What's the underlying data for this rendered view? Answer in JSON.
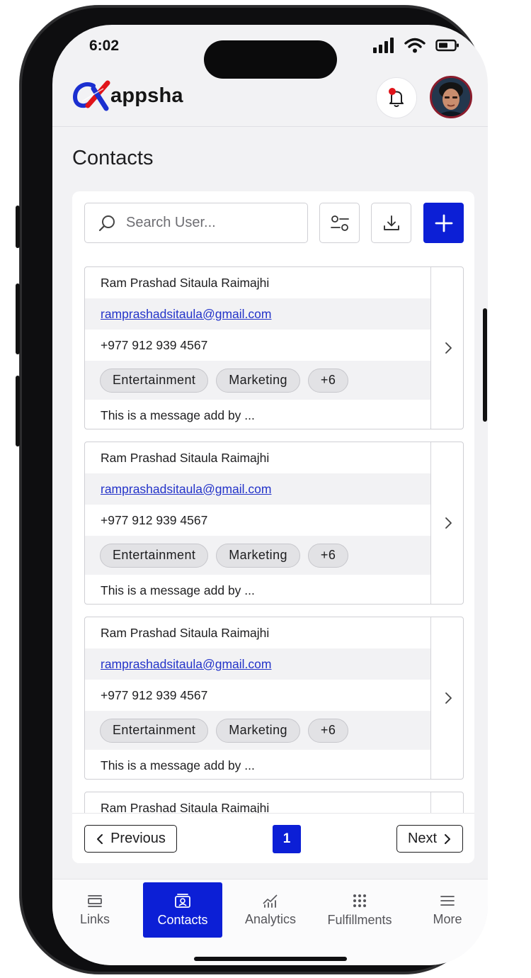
{
  "status_bar": {
    "time": "6:02"
  },
  "brand": {
    "name": "appsha"
  },
  "page": {
    "title": "Contacts"
  },
  "toolbar": {
    "search_placeholder": "Search User..."
  },
  "contacts": [
    {
      "name": "Ram Prashad Sitaula Raimajhi",
      "email": "ramprashadsitaula@gmail.com",
      "phone": "+977 912 939 4567",
      "tags": [
        "Entertainment",
        "Marketing",
        "+6"
      ],
      "message": "This is a message add by ..."
    },
    {
      "name": "Ram Prashad Sitaula Raimajhi",
      "email": "ramprashadsitaula@gmail.com",
      "phone": "+977 912 939 4567",
      "tags": [
        "Entertainment",
        "Marketing",
        "+6"
      ],
      "message": "This is a message add by ..."
    },
    {
      "name": "Ram Prashad Sitaula Raimajhi",
      "email": "ramprashadsitaula@gmail.com",
      "phone": "+977 912 939 4567",
      "tags": [
        "Entertainment",
        "Marketing",
        "+6"
      ],
      "message": "This is a message add by ..."
    },
    {
      "name": "Ram Prashad Sitaula Raimajhi",
      "email": "",
      "phone": "",
      "tags": [],
      "message": ""
    }
  ],
  "pagination": {
    "previous_label": "Previous",
    "current_page": "1",
    "next_label": "Next"
  },
  "bottom_nav": [
    {
      "label": "Links",
      "icon": "links-icon",
      "active": false
    },
    {
      "label": "Contacts",
      "icon": "contacts-icon",
      "active": true
    },
    {
      "label": "Analytics",
      "icon": "analytics-icon",
      "active": false
    },
    {
      "label": "Fulfillments",
      "icon": "grid-dots-icon",
      "active": false
    },
    {
      "label": "More",
      "icon": "menu-icon",
      "active": false
    }
  ],
  "colors": {
    "accent": "#0c1fd6",
    "notification_dot": "#e0141a",
    "link": "#2333c9"
  }
}
